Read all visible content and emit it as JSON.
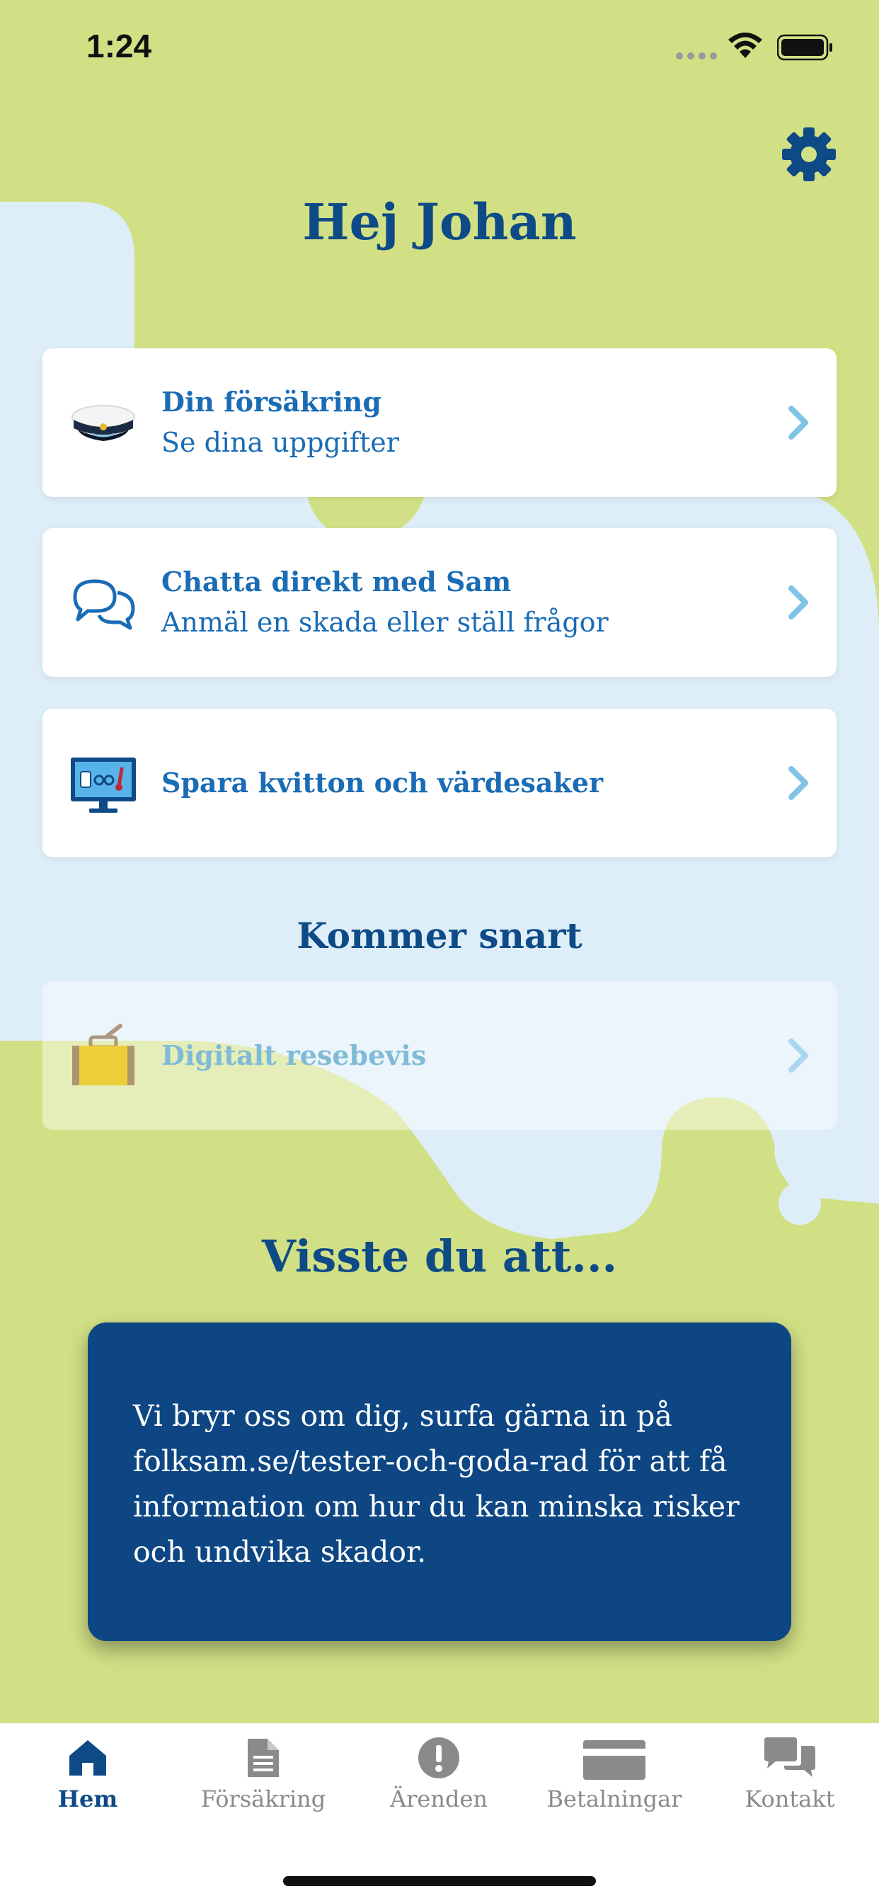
{
  "status_bar": {
    "time": "1:24"
  },
  "header": {
    "greeting": "Hej Johan",
    "settings_icon": "gear-icon"
  },
  "cards": [
    {
      "icon": "student-cap-icon",
      "title": "Din försäkring",
      "subtitle": "Se dina uppgifter"
    },
    {
      "icon": "chat-bubbles-icon",
      "title": "Chatta direkt med Sam",
      "subtitle": "Anmäl en skada eller ställ frågor"
    },
    {
      "icon": "monitor-icon",
      "title": "Spara kvitton och värdesaker"
    }
  ],
  "coming_soon": {
    "heading": "Kommer snart",
    "items": [
      {
        "icon": "suitcase-icon",
        "title": "Digitalt resebevis"
      }
    ]
  },
  "tip": {
    "heading": "Visste du att...",
    "text": "Vi bryr oss om dig, surfa gärna in på folksam.se/tester-och-goda-rad för att få information om hur du kan minska risker och undvika skador."
  },
  "tab_bar": {
    "tabs": [
      {
        "label": "Hem",
        "icon": "home-icon",
        "active": true
      },
      {
        "label": "Försäkring",
        "icon": "document-icon",
        "active": false
      },
      {
        "label": "Ärenden",
        "icon": "exclamation-icon",
        "active": false
      },
      {
        "label": "Betalningar",
        "icon": "credit-card-icon",
        "active": false
      },
      {
        "label": "Kontakt",
        "icon": "chat-icon",
        "active": false
      }
    ]
  },
  "colors": {
    "green_background": "#d2e085",
    "blue_blob": "#ddeef8",
    "navy": "#0e4a86",
    "link_blue": "#1a6cb5",
    "chevron": "#7fc4e6"
  }
}
